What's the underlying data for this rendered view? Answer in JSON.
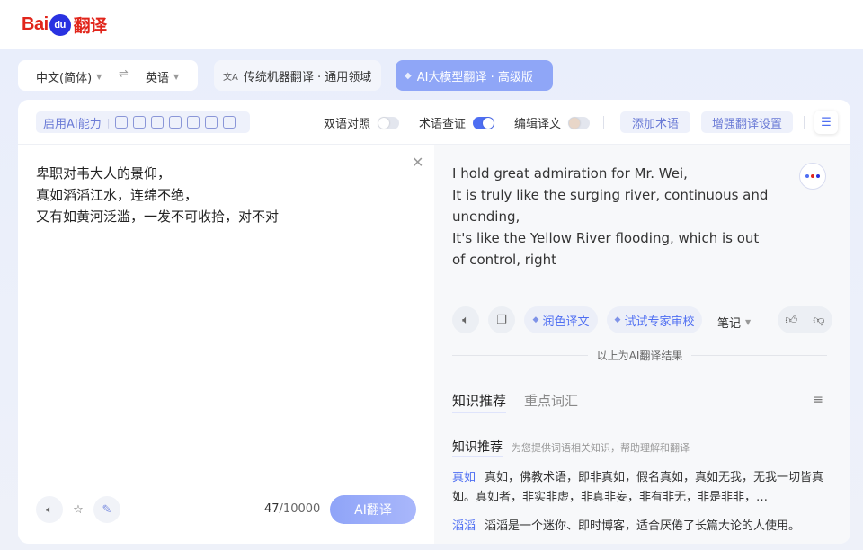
{
  "header": {
    "logo": {
      "bai": "Bai",
      "du": "du",
      "fanyi": "翻译"
    }
  },
  "lang": {
    "source": "中文(简体)",
    "swap": "⇌",
    "target": "英语"
  },
  "modes": {
    "traditional": "传统机器翻译 · 通用领域",
    "ai": "AI大模型翻译 · 高级版"
  },
  "toolbar": {
    "ai_ability": "启用AI能力",
    "bilingual": "双语对照",
    "term_check": "术语查证",
    "edit_translation": "编辑译文",
    "add_term": "添加术语",
    "enhance_settings": "增强翻译设置"
  },
  "source": {
    "text": "卑职对韦大人的景仰，\n真如滔滔江水，连绵不绝，\n又有如黄河泛滥，一发不可收拾，对不对",
    "count": "47",
    "max": "/10000",
    "translate_btn": "AI翻译"
  },
  "target": {
    "text": "I hold great admiration for Mr. Wei,\nIt is truly like the surging river, continuous and unending,\nIt's like the Yellow River flooding, which is out of control, right",
    "polish": "润色译文",
    "expert_review": "试试专家审校",
    "notes": "笔记",
    "ai_result_label": "以上为AI翻译结果"
  },
  "knowledge": {
    "tabs": [
      "知识推荐",
      "重点词汇"
    ],
    "heading": "知识推荐",
    "subheading": "为您提供词语相关知识，帮助理解和翻译",
    "entries": [
      {
        "term": "真如",
        "desc": "真如，佛教术语，即非真如，假名真如，真如无我，无我一切皆真如。真如者，非实非虚，非真非妄，非有非无，非是非非，…"
      },
      {
        "term": "滔滔",
        "desc": "滔滔是一个迷你、即时博客，适合厌倦了长篇大论的人使用。"
      }
    ]
  },
  "colors": {
    "brand_red": "#e1251b",
    "brand_blue": "#2932e1",
    "accent": "#4e6ef2",
    "ai_button": "#8fa6f7"
  }
}
